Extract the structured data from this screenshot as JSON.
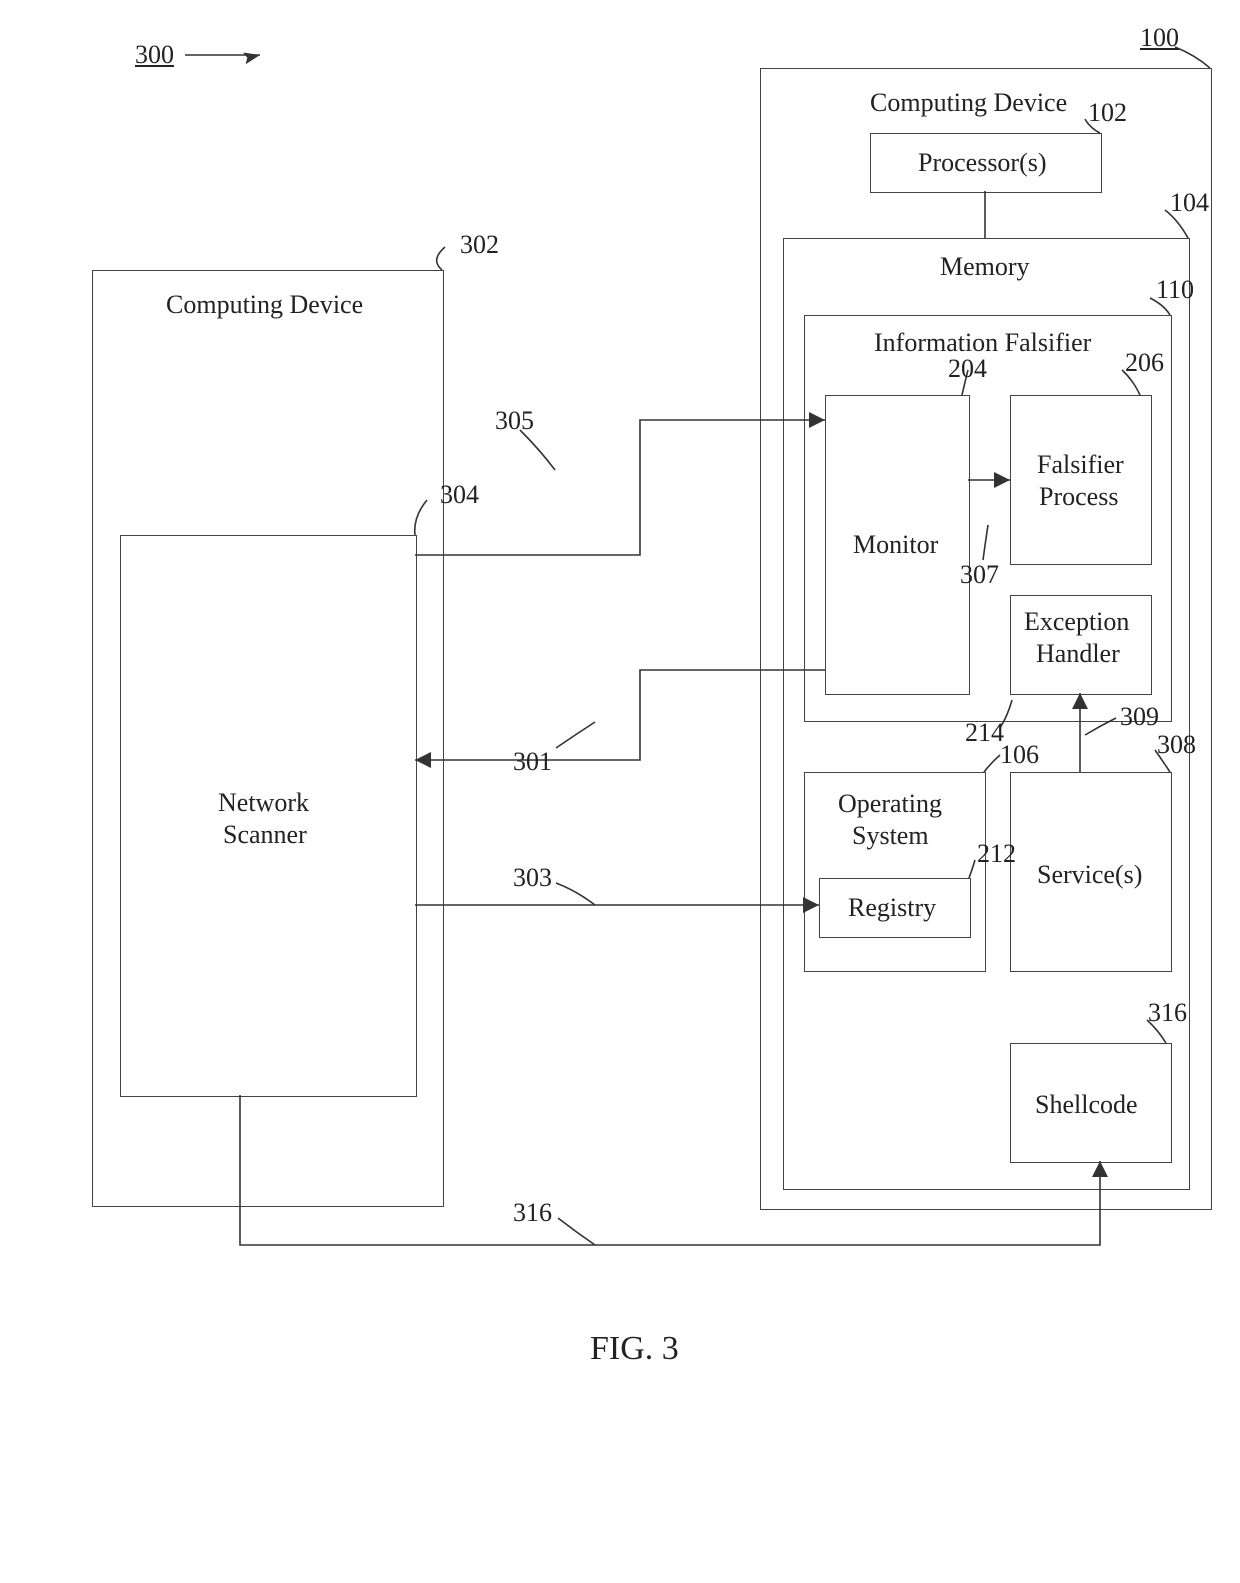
{
  "figure_label": "FIG. 3",
  "refs": {
    "r300": "300",
    "r100": "100",
    "r302": "302",
    "r304": "304",
    "r305": "305",
    "r301": "301",
    "r303": "303",
    "r316a": "316",
    "r102": "102",
    "r104": "104",
    "r110": "110",
    "r206": "206",
    "r204": "204",
    "r307": "307",
    "r309": "309",
    "r214": "214",
    "r106": "106",
    "r212": "212",
    "r308": "308",
    "r316b": "316"
  },
  "blocks": {
    "compdev_left": "Computing Device",
    "netscan1": "Network",
    "netscan2": "Scanner",
    "compdev_right": "Computing Device",
    "processors": "Processor(s)",
    "memory": "Memory",
    "info_falsifier": "Information Falsifier",
    "monitor": "Monitor",
    "fal_proc1": "Falsifier",
    "fal_proc2": "Process",
    "exc1": "Exception",
    "exc2": "Handler",
    "os1": "Operating",
    "os2": "System",
    "registry": "Registry",
    "services": "Service(s)",
    "shellcode": "Shellcode"
  }
}
